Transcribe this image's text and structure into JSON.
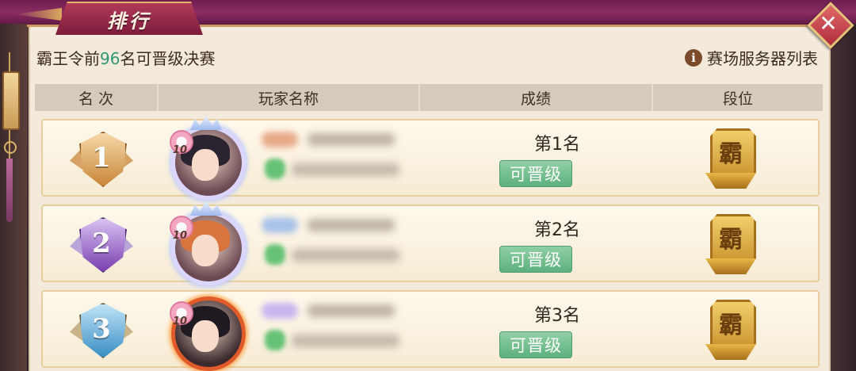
{
  "window": {
    "title": "排行",
    "close_symbol": "✕"
  },
  "info": {
    "prefix": "霸王令前",
    "count": "96",
    "suffix": "名可晋级决赛",
    "server_link": "赛场服务器列表",
    "info_glyph": "i"
  },
  "table": {
    "headers": [
      "名 次",
      "玩家名称",
      "成绩",
      "段位"
    ]
  },
  "rows": [
    {
      "rank": "1",
      "avatar_level": "10",
      "score": "第1名",
      "status": "可晋级",
      "tier": "霸"
    },
    {
      "rank": "2",
      "avatar_level": "10",
      "score": "第2名",
      "status": "可晋级",
      "tier": "霸"
    },
    {
      "rank": "3",
      "avatar_level": "10",
      "score": "第3名",
      "status": "可晋级",
      "tier": "霸"
    }
  ],
  "colors": {
    "highlight": "#2e9a74",
    "rank1": "#c9873a",
    "rank2": "#7a3fb0",
    "rank3": "#3a8fc6",
    "promo": "#5db07e"
  },
  "icons": {
    "close": "close-icon",
    "info": "info-icon",
    "rank": "rank-medal-icon",
    "tier": "tier-emblem-icon"
  }
}
